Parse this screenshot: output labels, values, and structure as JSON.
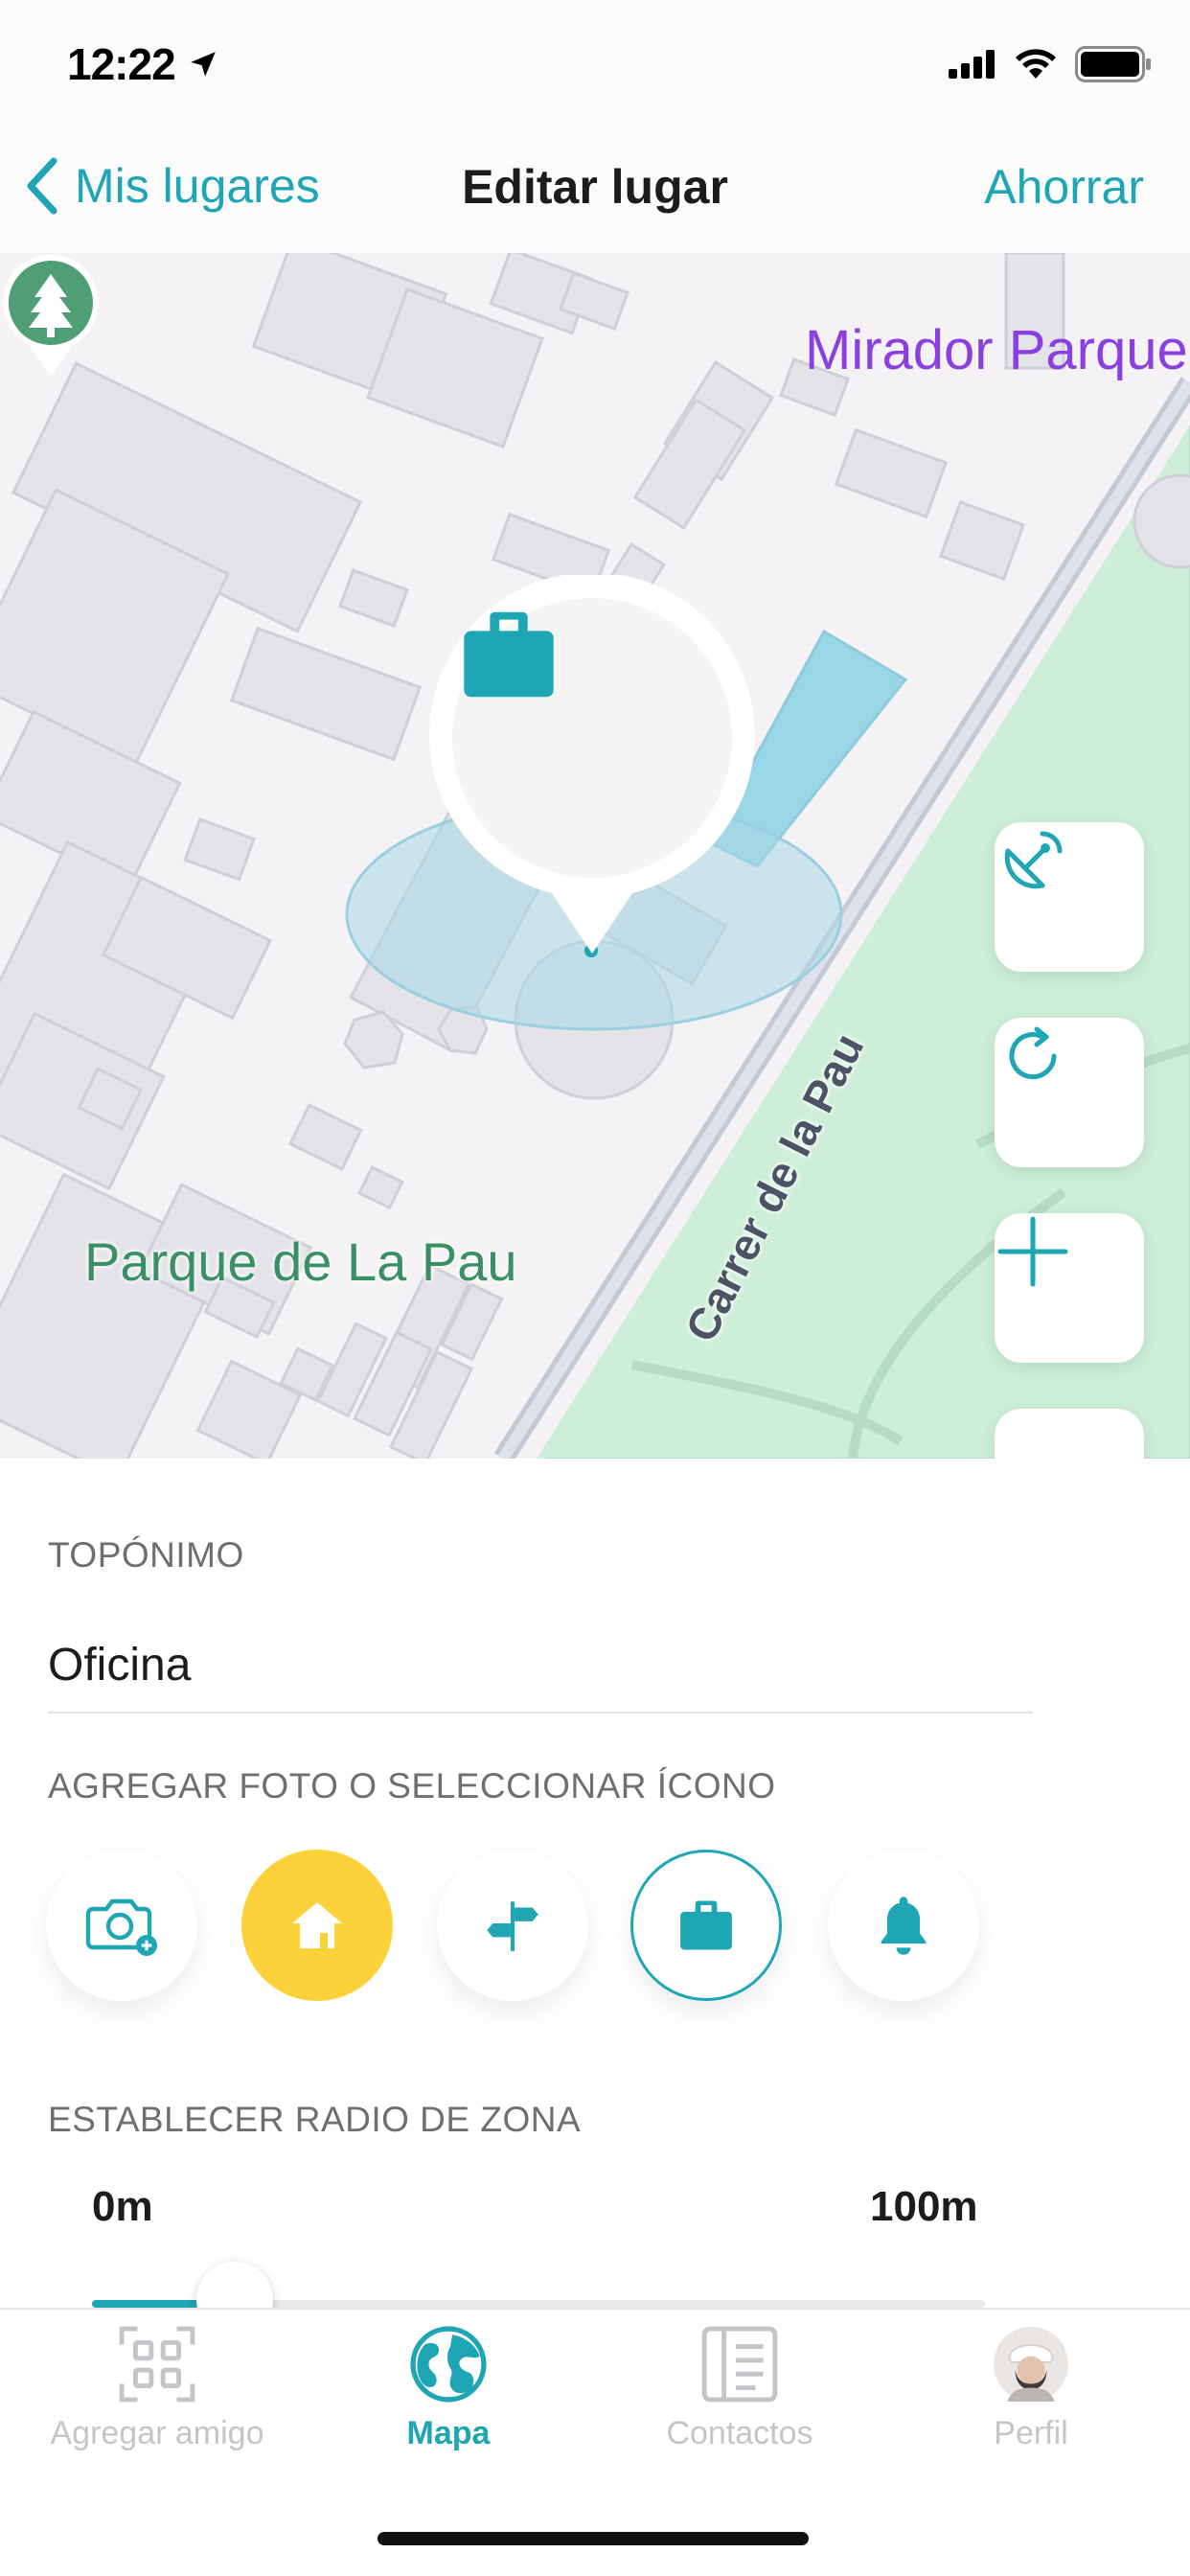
{
  "status_bar": {
    "time": "12:22"
  },
  "nav": {
    "back_label": "Mis lugares",
    "title": "Editar lugar",
    "save_label": "Ahorrar"
  },
  "map": {
    "labels": {
      "mirador": "Mirador Parque",
      "street": "Carrer de la Pau",
      "park": "Parque de La Pau"
    },
    "place_icon": "briefcase-icon",
    "controls": [
      "satellite-icon",
      "refresh-icon",
      "zoom-in-icon"
    ]
  },
  "form": {
    "name_section_label": "TOPÓNIMO",
    "name_value": "Oficina",
    "icon_section_label": "AGREGAR FOTO O SELECCIONAR ÍCONO",
    "icon_options": [
      {
        "name": "add-photo-icon",
        "selected": false
      },
      {
        "name": "home-icon",
        "selected": false
      },
      {
        "name": "signpost-icon",
        "selected": false
      },
      {
        "name": "briefcase-icon",
        "selected": true
      },
      {
        "name": "bell-icon",
        "selected": false
      }
    ],
    "radius_section_label": "ESTABLECER RADIO DE ZONA",
    "radius_min_label": "0m",
    "radius_max_label": "100m",
    "radius_fraction": 0.16
  },
  "tab_bar": {
    "tabs": [
      {
        "label": "Agregar amigo",
        "icon": "qr-code-icon",
        "active": false
      },
      {
        "label": "Mapa",
        "icon": "globe-icon",
        "active": true
      },
      {
        "label": "Contactos",
        "icon": "contacts-list-icon",
        "active": false
      },
      {
        "label": "Perfil",
        "icon": "avatar",
        "active": false
      }
    ]
  },
  "colors": {
    "accent": "#1fa6b4",
    "home_yellow": "#fbd239",
    "park_green": "#3b8f65",
    "poi_purple": "#8a3fe0"
  }
}
